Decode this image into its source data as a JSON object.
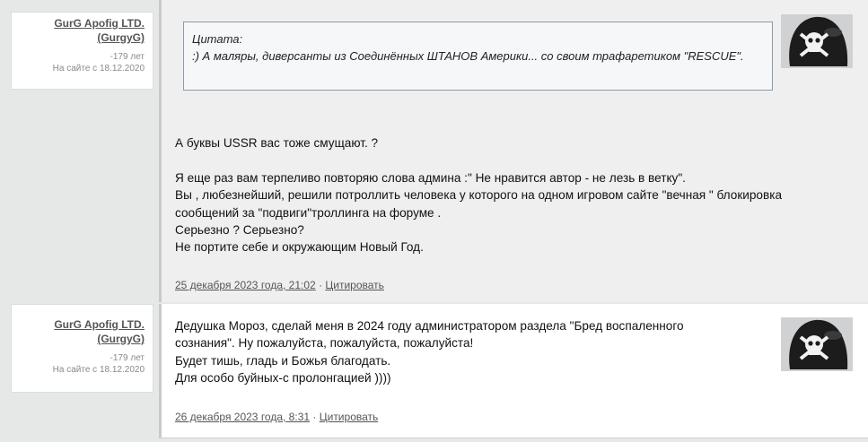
{
  "posts": [
    {
      "author": {
        "name_line1": "GurG Apofig LTD.",
        "name_line2": "(GurgyG)",
        "age": "-179 лет",
        "member_since": "На сайте с 18.12.2020"
      },
      "quote": {
        "label": "Цитата:",
        "text": ":) А маляры, диверсанты из Соединённых ШТАНОВ Америки... со своим трафаретиком \"RESCUE\"."
      },
      "paragraphs": [
        "А буквы USSR вас тоже смущают. ?",
        "",
        "Я еще раз вам терпеливо повторяю слова админа :\" Не нравится автор - не лезь в ветку\".",
        "Вы , любезнейший, решили потроллить человека у которого на одном игровом сайте \"вечная \" блокировка сообщений за \"подвиги\"троллинга на форуме .",
        "Серьезно ? Серьезно?",
        "Не портите себе и окружающим Новый Год."
      ],
      "date": "25 декабря 2023 года, 21:02",
      "separator": "·",
      "quote_action": "Цитировать",
      "avatar_icon": "pirate-skull-avatar-icon"
    },
    {
      "author": {
        "name_line1": "GurG Apofig LTD.",
        "name_line2": "(GurgyG)",
        "age": "-179 лет",
        "member_since": "На сайте с 18.12.2020"
      },
      "paragraphs": [
        "Дедушка Мороз, сделай меня в 2024 году администратором раздела \"Бред воспаленного сознания\". Ну пожалуйста, пожалуйста, пожалуйста!",
        "Будет тишь, гладь и Божья благодать.",
        "Для особо буйных-с пролонгацией ))))"
      ],
      "date": "26 декабря 2023 года, 8:31",
      "separator": "·",
      "quote_action": "Цитировать",
      "avatar_icon": "pirate-skull-avatar-icon"
    }
  ]
}
